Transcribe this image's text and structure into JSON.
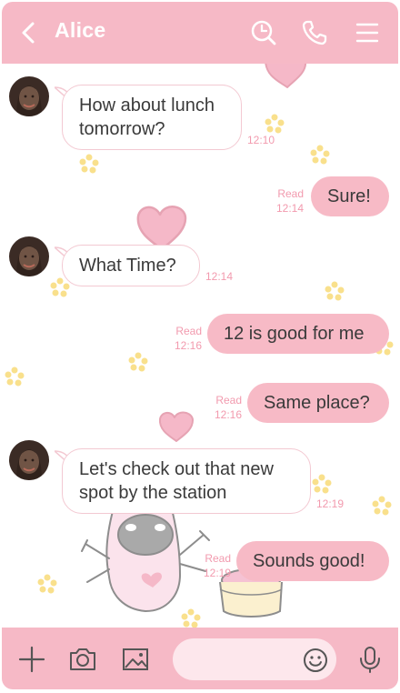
{
  "header": {
    "title": "Alice",
    "back_icon": "chevron-left-icon",
    "icons": [
      "search-icon",
      "phone-icon",
      "menu-icon"
    ],
    "background": "#f6b9c6"
  },
  "messages": [
    {
      "direction": "incoming",
      "lines": [
        "How about lunch",
        "tomorrow?"
      ],
      "time": "12:10"
    },
    {
      "direction": "outgoing",
      "text": "Sure!",
      "status": "Read",
      "time": "12:14"
    },
    {
      "direction": "incoming",
      "text": "What Time?",
      "time": "12:14"
    },
    {
      "direction": "outgoing",
      "text": "12 is good for me",
      "status": "Read",
      "time": "12:16"
    },
    {
      "direction": "outgoing",
      "text": "Same place?",
      "status": "Read",
      "time": "12:16"
    },
    {
      "direction": "incoming",
      "lines": [
        "Let's check out that new",
        "spot by the station"
      ],
      "time": "12:19"
    },
    {
      "direction": "outgoing",
      "text": "Sounds good!",
      "status": "Read",
      "time": "12:19"
    }
  ],
  "composer": {
    "icons": [
      "plus-icon",
      "camera-icon",
      "image-icon",
      "emoji-icon",
      "microphone-icon"
    ],
    "input_value": "",
    "input_placeholder": ""
  },
  "colors": {
    "accent": "#f6b9c6",
    "outgoing_bubble": "#f7bac6",
    "timestamp": "#f29aae",
    "heart": "#f5b8c8",
    "flower": "#f9e08c"
  }
}
